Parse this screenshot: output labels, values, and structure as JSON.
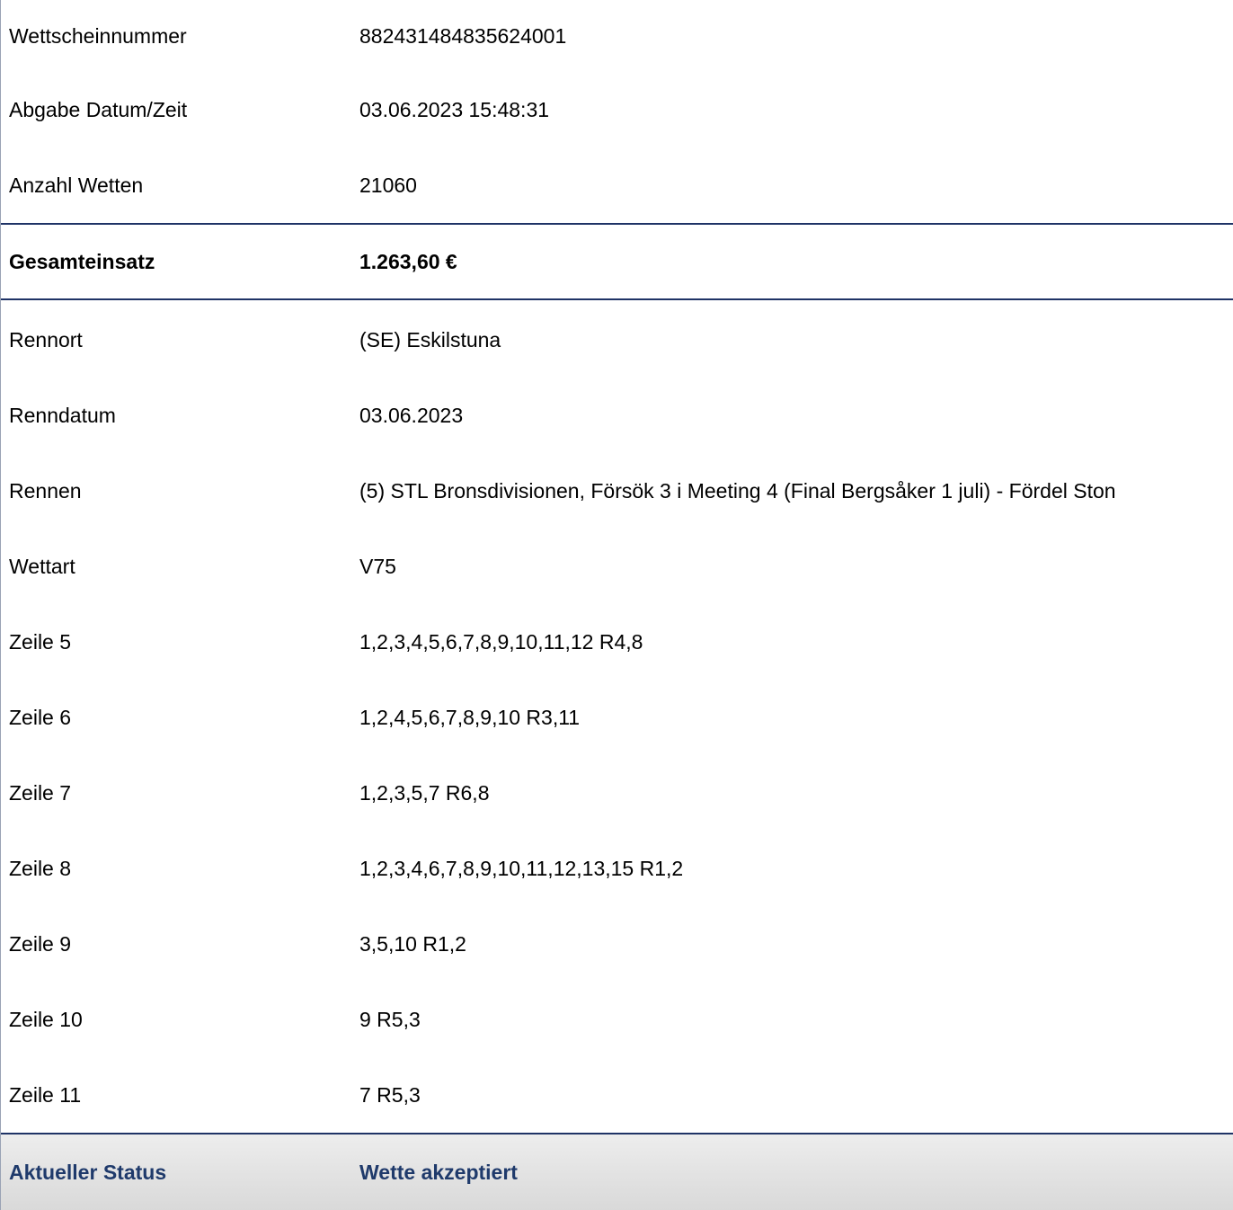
{
  "ticket": {
    "header_rows": [
      {
        "label": "Wettscheinnummer",
        "value": "882431484835624001"
      },
      {
        "label": "Abgabe Datum/Zeit",
        "value": "03.06.2023 15:48:31"
      },
      {
        "label": "Anzahl Wetten",
        "value": "21060"
      }
    ],
    "total": {
      "label": "Gesamteinsatz",
      "value": "1.263,60 €"
    },
    "detail_rows": [
      {
        "label": "Rennort",
        "value": "(SE) Eskilstuna"
      },
      {
        "label": "Renndatum",
        "value": "03.06.2023"
      },
      {
        "label": "Rennen",
        "value": "(5) STL Bronsdivisionen, Försök 3 i Meeting 4 (Final Bergsåker 1 juli) - Fördel Ston"
      },
      {
        "label": "Wettart",
        "value": "V75"
      },
      {
        "label": "Zeile 5",
        "value": "1,2,3,4,5,6,7,8,9,10,11,12 R4,8"
      },
      {
        "label": "Zeile 6",
        "value": "1,2,4,5,6,7,8,9,10 R3,11"
      },
      {
        "label": "Zeile 7",
        "value": "1,2,3,5,7 R6,8"
      },
      {
        "label": "Zeile 8",
        "value": "1,2,3,4,6,7,8,9,10,11,12,13,15 R1,2"
      },
      {
        "label": "Zeile 9",
        "value": "3,5,10 R1,2"
      },
      {
        "label": "Zeile 10",
        "value": "9 R5,3"
      },
      {
        "label": "Zeile 11",
        "value": "7 R5,3"
      }
    ],
    "status": {
      "label": "Aktueller Status",
      "value": "Wette akzeptiert"
    }
  },
  "colors": {
    "accent": "#1f3366",
    "status_text": "#1f3a6b",
    "status_bg": "#e3e3e3"
  }
}
